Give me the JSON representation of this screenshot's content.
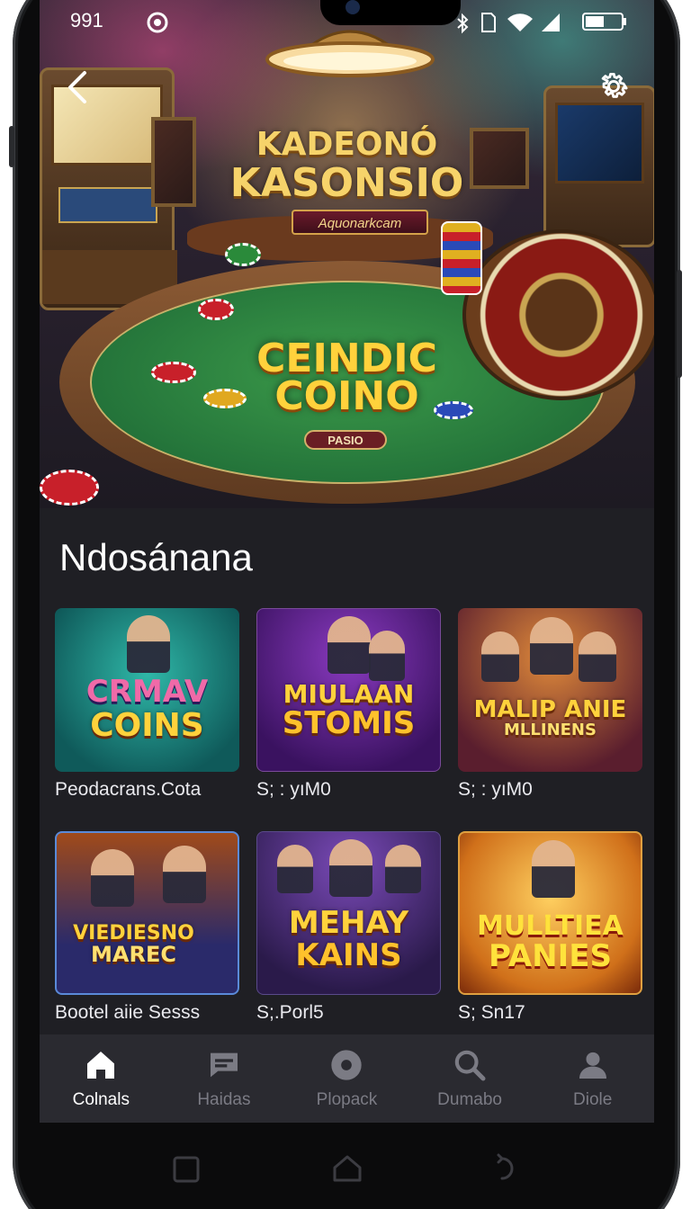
{
  "status_bar": {
    "time": "991"
  },
  "hero": {
    "title_line1": "KADEONÓ",
    "title_line2": "KASONSIO",
    "ribbon": "Aquonarkcam",
    "logo_line1": "CEINDIC",
    "logo_line2": "COINO",
    "pill": "PASIO"
  },
  "section": {
    "title": "Ndosánana"
  },
  "cards": [
    {
      "thumb_line1": "CRMAV",
      "thumb_line2": "COINS",
      "label": "Peodacrans.Cota"
    },
    {
      "thumb_line1": "MIULAAN",
      "thumb_line2": "STOMIS",
      "label": "S; : yıM0"
    },
    {
      "thumb_line1": "MALIP ANIE",
      "thumb_line2": "MLLINENS",
      "label": "S; : yıM0"
    },
    {
      "thumb_line1": "VIEDIESNO",
      "thumb_line2": "MAREC",
      "label": "Bootel aiie Sesss"
    },
    {
      "thumb_line1": "MEHAY",
      "thumb_line2": "KAINS",
      "label": "S;.Porl5"
    },
    {
      "thumb_line1": "MULLTIEA",
      "thumb_line2": "PANIES",
      "label": "S; Sn17"
    }
  ],
  "bottom_nav": [
    {
      "label": "Colnals",
      "icon": "home-icon",
      "active": true
    },
    {
      "label": "Haidas",
      "icon": "chat-icon",
      "active": false
    },
    {
      "label": "Plopack",
      "icon": "record-icon",
      "active": false
    },
    {
      "label": "Dumabo",
      "icon": "search-icon",
      "active": false
    },
    {
      "label": "Diole",
      "icon": "profile-icon",
      "active": false
    }
  ],
  "colors": {
    "screen_bg": "#1f1f24",
    "nav_bg": "#2a2a30",
    "gold": "#f6d36a",
    "active_label": "#ffffff",
    "inactive_label": "#7b7b84"
  }
}
